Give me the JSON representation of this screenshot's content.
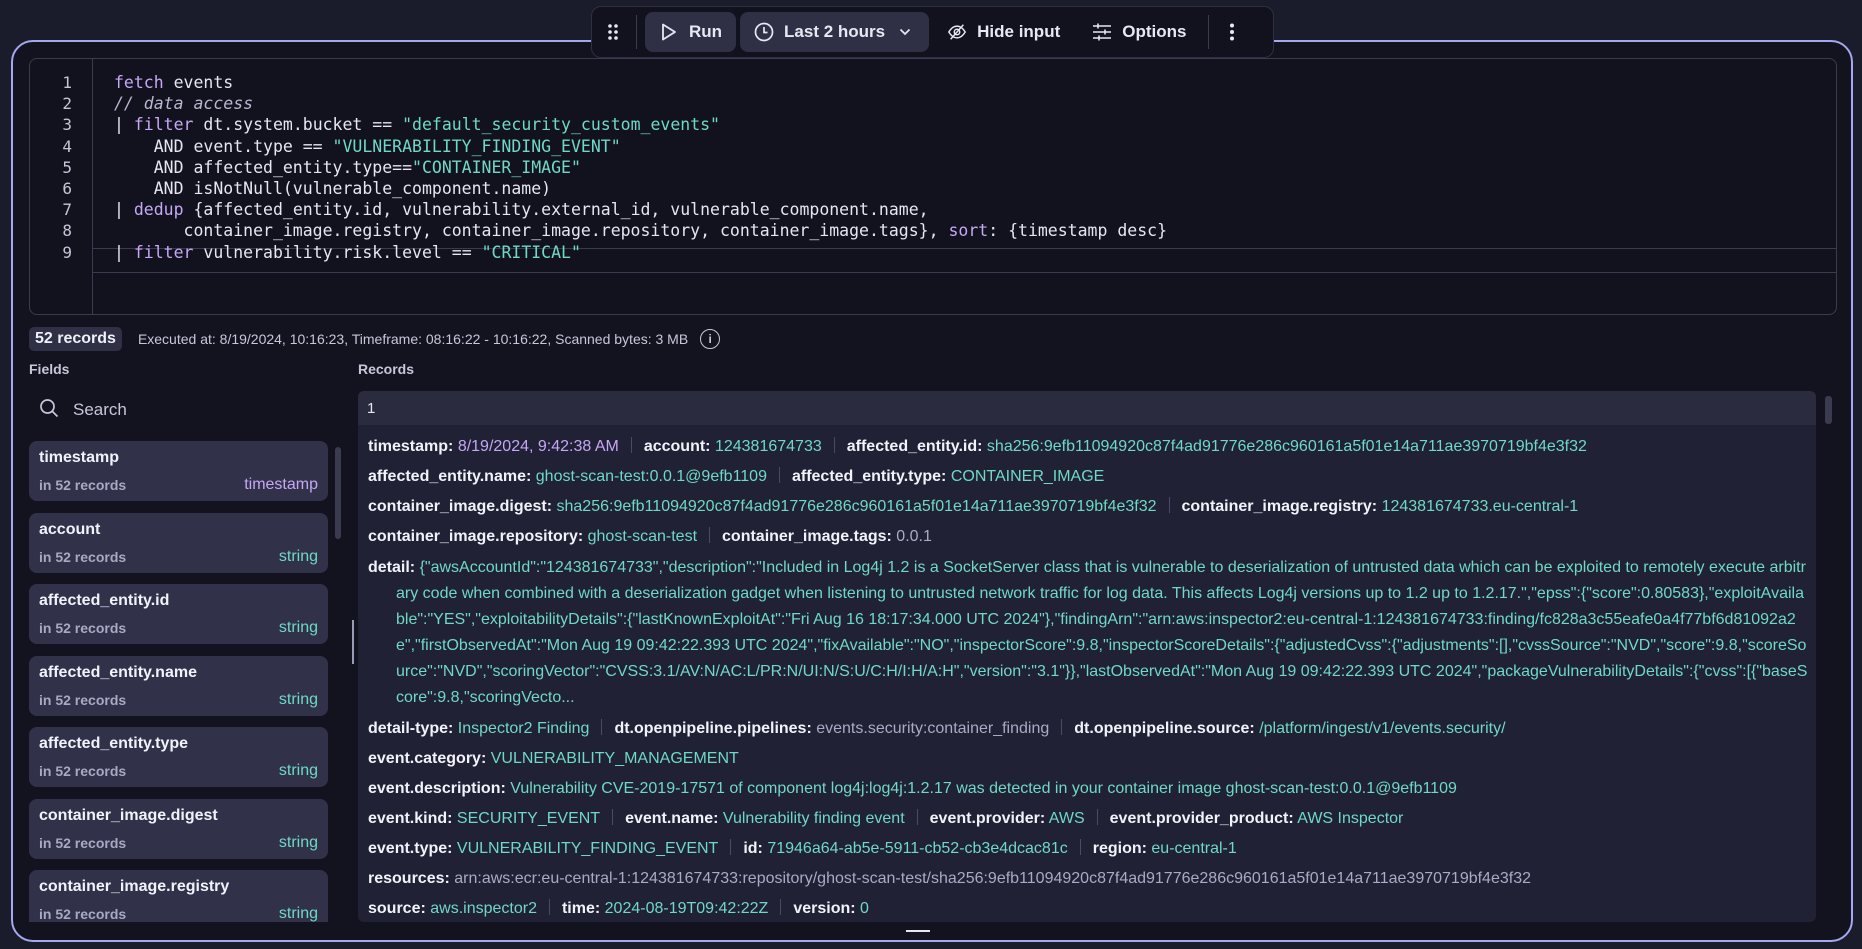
{
  "toolbar": {
    "drag_icon": "drag-handle-icon",
    "run_label": "Run",
    "timeframe_label": "Last 2 hours",
    "hide_input_label": "Hide input",
    "options_label": "Options"
  },
  "editor": {
    "line_numbers": [
      "1",
      "2",
      "3",
      "4",
      "5",
      "6",
      "7",
      "8",
      "9"
    ],
    "lines": [
      [
        {
          "t": "fetch",
          "c": "kw"
        },
        {
          "t": " events",
          "c": ""
        }
      ],
      [
        {
          "t": "// data access",
          "c": "cm"
        }
      ],
      [
        {
          "t": "| ",
          "c": ""
        },
        {
          "t": "filter",
          "c": "kw"
        },
        {
          "t": " dt.system.bucket == ",
          "c": ""
        },
        {
          "t": "\"default_security_custom_events\"",
          "c": "str"
        }
      ],
      [
        {
          "t": "    AND event.type == ",
          "c": ""
        },
        {
          "t": "\"VULNERABILITY_FINDING_EVENT\"",
          "c": "str"
        }
      ],
      [
        {
          "t": "    AND affected_entity.type==",
          "c": ""
        },
        {
          "t": "\"CONTAINER_IMAGE\"",
          "c": "str"
        }
      ],
      [
        {
          "t": "    AND isNotNull(vulnerable_component.name)",
          "c": ""
        }
      ],
      [
        {
          "t": "| ",
          "c": ""
        },
        {
          "t": "dedup",
          "c": "kw"
        },
        {
          "t": " {affected_entity.id, vulnerability.external_id, vulnerable_component.name,",
          "c": ""
        }
      ],
      [
        {
          "t": "       container_image.registry, container_image.repository, container_image.tags}, ",
          "c": ""
        },
        {
          "t": "sort",
          "c": "kw"
        },
        {
          "t": ": {timestamp desc}",
          "c": ""
        }
      ],
      [
        {
          "t": "| ",
          "c": ""
        },
        {
          "t": "filter",
          "c": "kw"
        },
        {
          "t": " vulnerability.risk.level == ",
          "c": ""
        },
        {
          "t": "\"CRITICAL\"",
          "c": "str"
        }
      ]
    ]
  },
  "stats": {
    "records_badge": "52 records",
    "executed_text": "Executed at: 8/19/2024, 10:16:23, Timeframe: 08:16:22 - 10:16:22, Scanned bytes: 3 MB"
  },
  "fields_panel": {
    "label": "Fields",
    "search_placeholder": "Search",
    "items": [
      {
        "name": "timestamp",
        "count": "in 52 records",
        "type": "timestamp"
      },
      {
        "name": "account",
        "count": "in 52 records",
        "type": "string"
      },
      {
        "name": "affected_entity.id",
        "count": "in 52 records",
        "type": "string"
      },
      {
        "name": "affected_entity.name",
        "count": "in 52 records",
        "type": "string"
      },
      {
        "name": "affected_entity.type",
        "count": "in 52 records",
        "type": "string"
      },
      {
        "name": "container_image.digest",
        "count": "in 52 records",
        "type": "string"
      },
      {
        "name": "container_image.registry",
        "count": "in 52 records",
        "type": "string"
      }
    ]
  },
  "records_panel": {
    "label": "Records",
    "record_index": "1",
    "rows": [
      [
        {
          "k": "timestamp:",
          "v": "8/19/2024, 9:42:38 AM",
          "c": "ts"
        },
        {
          "k": "account:",
          "v": "124381674733"
        },
        {
          "k": "affected_entity.id:",
          "v": "sha256:9efb11094920c87f4ad91776e286c960161a5f01e14a711ae3970719bf4e3f32"
        }
      ],
      [
        {
          "k": "affected_entity.name:",
          "v": "ghost-scan-test:0.0.1@9efb1109"
        },
        {
          "k": "affected_entity.type:",
          "v": "CONTAINER_IMAGE"
        }
      ],
      [
        {
          "k": "container_image.digest:",
          "v": "sha256:9efb11094920c87f4ad91776e286c960161a5f01e14a711ae3970719bf4e3f32"
        },
        {
          "k": "container_image.registry:",
          "v": "124381674733.eu-central-1"
        }
      ],
      [
        {
          "k": "container_image.repository:",
          "v": "ghost-scan-test"
        },
        {
          "k": "container_image.tags:",
          "v": "0.0.1",
          "c": "muted"
        }
      ]
    ],
    "detail": {
      "k": "detail:",
      "v": "{\"awsAccountId\":\"124381674733\",\"description\":\"Included in Log4j 1.2 is a SocketServer class that is vulnerable to deserialization of untrusted data which can be exploited to remotely execute arbitrary code when combined with a deserialization gadget when listening to untrusted network traffic for log data. This affects Log4j versions up to 1.2 up to 1.2.17.\",\"epss\":{\"score\":0.80583},\"exploitAvailable\":\"YES\",\"exploitabilityDetails\":{\"lastKnownExploitAt\":\"Fri Aug 16 18:17:34.000 UTC 2024\"},\"findingArn\":\"arn:aws:inspector2:eu-central-1:124381674733:finding/fc828a3c55eafe0a4f77bf6d81092a2e\",\"firstObservedAt\":\"Mon Aug 19 09:42:22.393 UTC 2024\",\"fixAvailable\":\"NO\",\"inspectorScore\":9.8,\"inspectorScoreDetails\":{\"adjustedCvss\":{\"adjustments\":[],\"cvssSource\":\"NVD\",\"score\":9.8,\"scoreSource\":\"NVD\",\"scoringVector\":\"CVSS:3.1/AV:N/AC:L/PR:N/UI:N/S:U/C:H/I:H/A:H\",\"version\":\"3.1\"}},\"lastObservedAt\":\"Mon Aug 19 09:42:22.393 UTC 2024\",\"packageVulnerabilityDetails\":{\"cvss\":[{\"baseScore\":9.8,\"scoringVecto..."
    },
    "rows2": [
      [
        {
          "k": "detail-type:",
          "v": "Inspector2 Finding"
        },
        {
          "k": "dt.openpipeline.pipelines:",
          "v": "events.security:container_finding",
          "c": "muted"
        },
        {
          "k": "dt.openpipeline.source:",
          "v": "/platform/ingest/v1/events.security/"
        }
      ],
      [
        {
          "k": "event.category:",
          "v": "VULNERABILITY_MANAGEMENT"
        }
      ],
      [
        {
          "k": "event.description:",
          "v": "Vulnerability CVE-2019-17571 of component log4j:log4j:1.2.17 was detected in your container image ghost-scan-test:0.0.1@9efb1109"
        }
      ],
      [
        {
          "k": "event.kind:",
          "v": "SECURITY_EVENT"
        },
        {
          "k": "event.name:",
          "v": "Vulnerability finding event"
        },
        {
          "k": "event.provider:",
          "v": "AWS"
        },
        {
          "k": "event.provider_product:",
          "v": "AWS Inspector"
        }
      ],
      [
        {
          "k": "event.type:",
          "v": "VULNERABILITY_FINDING_EVENT"
        },
        {
          "k": "id:",
          "v": "71946a64-ab5e-5911-cb52-cb3e4dcac81c"
        },
        {
          "k": "region:",
          "v": "eu-central-1"
        }
      ],
      [
        {
          "k": "resources:",
          "v": "arn:aws:ecr:eu-central-1:124381674733:repository/ghost-scan-test/sha256:9efb11094920c87f4ad91776e286c960161a5f01e14a711ae3970719bf4e3f32",
          "c": "muted"
        }
      ],
      [
        {
          "k": "source:",
          "v": "aws.inspector2"
        },
        {
          "k": "time:",
          "v": "2024-08-19T09:42:22Z"
        },
        {
          "k": "version:",
          "v": "0"
        }
      ]
    ]
  },
  "colors": {
    "accent_border": "#a3a8f0",
    "value_teal": "#6fd8c6",
    "timestamp_purple": "#c7a6f5",
    "background": "#131320"
  }
}
